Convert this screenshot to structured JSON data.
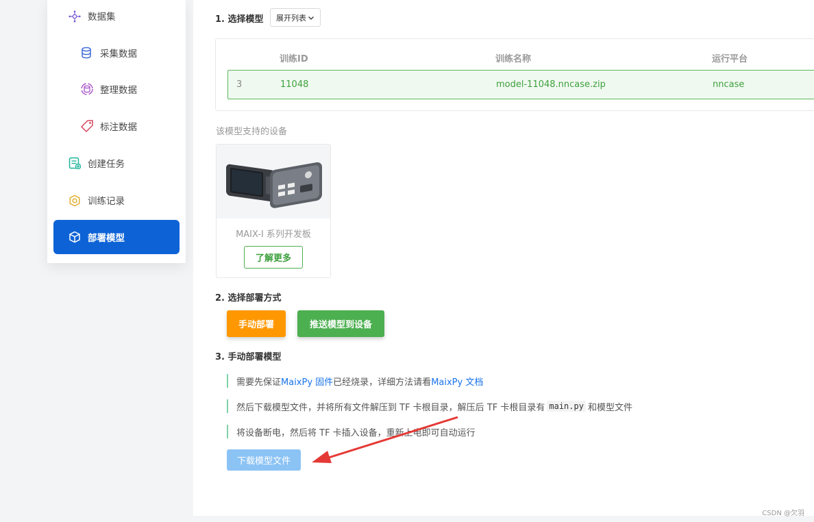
{
  "sidebar": {
    "items": [
      {
        "label": "数据集",
        "icon": "dataset-icon"
      },
      {
        "label": "采集数据",
        "icon": "database-icon"
      },
      {
        "label": "整理数据",
        "icon": "sync-database-icon"
      },
      {
        "label": "标注数据",
        "icon": "tag-icon"
      },
      {
        "label": "创建任务",
        "icon": "task-icon"
      },
      {
        "label": "训练记录",
        "icon": "record-icon"
      },
      {
        "label": "部署模型",
        "icon": "cube-icon"
      }
    ]
  },
  "step1": {
    "title": "1. 选择模型",
    "expand_label": "展开列表",
    "columns": [
      "训练ID",
      "训练名称",
      "运行平台"
    ],
    "row": {
      "index": "3",
      "id": "11048",
      "name": "model-11048.nncase.zip",
      "platform": "nncase"
    }
  },
  "supported_label": "该模型支持的设备",
  "device": {
    "name": "MAIX-I 系列开发板",
    "learn_more": "了解更多"
  },
  "step2": {
    "title": "2. 选择部署方式",
    "manual_label": "手动部署",
    "push_label": "推送模型到设备"
  },
  "step3": {
    "title": "3. 手动部署模型",
    "line1": {
      "pre": "需要先保证 ",
      "link1": "MaixPy 固件",
      "mid": " 已经烧录，详细方法请看 ",
      "link2": "MaixPy 文档"
    },
    "line2": {
      "pre": "然后下载模型文件，并将所有文件解压到 TF 卡根目录，解压后 TF 卡根目录有",
      "code": "main.py",
      "post": " 和模型文件"
    },
    "line3": "将设备断电，然后将 TF 卡插入设备，重新上电即可自动运行",
    "download_label": "下载模型文件"
  },
  "watermark": "CSDN @欠羽",
  "colors": {
    "active": "#0d63d6",
    "orange": "#ff9800",
    "green": "#4caf50",
    "link": "#1a73e8",
    "arrow": "#e53935"
  }
}
